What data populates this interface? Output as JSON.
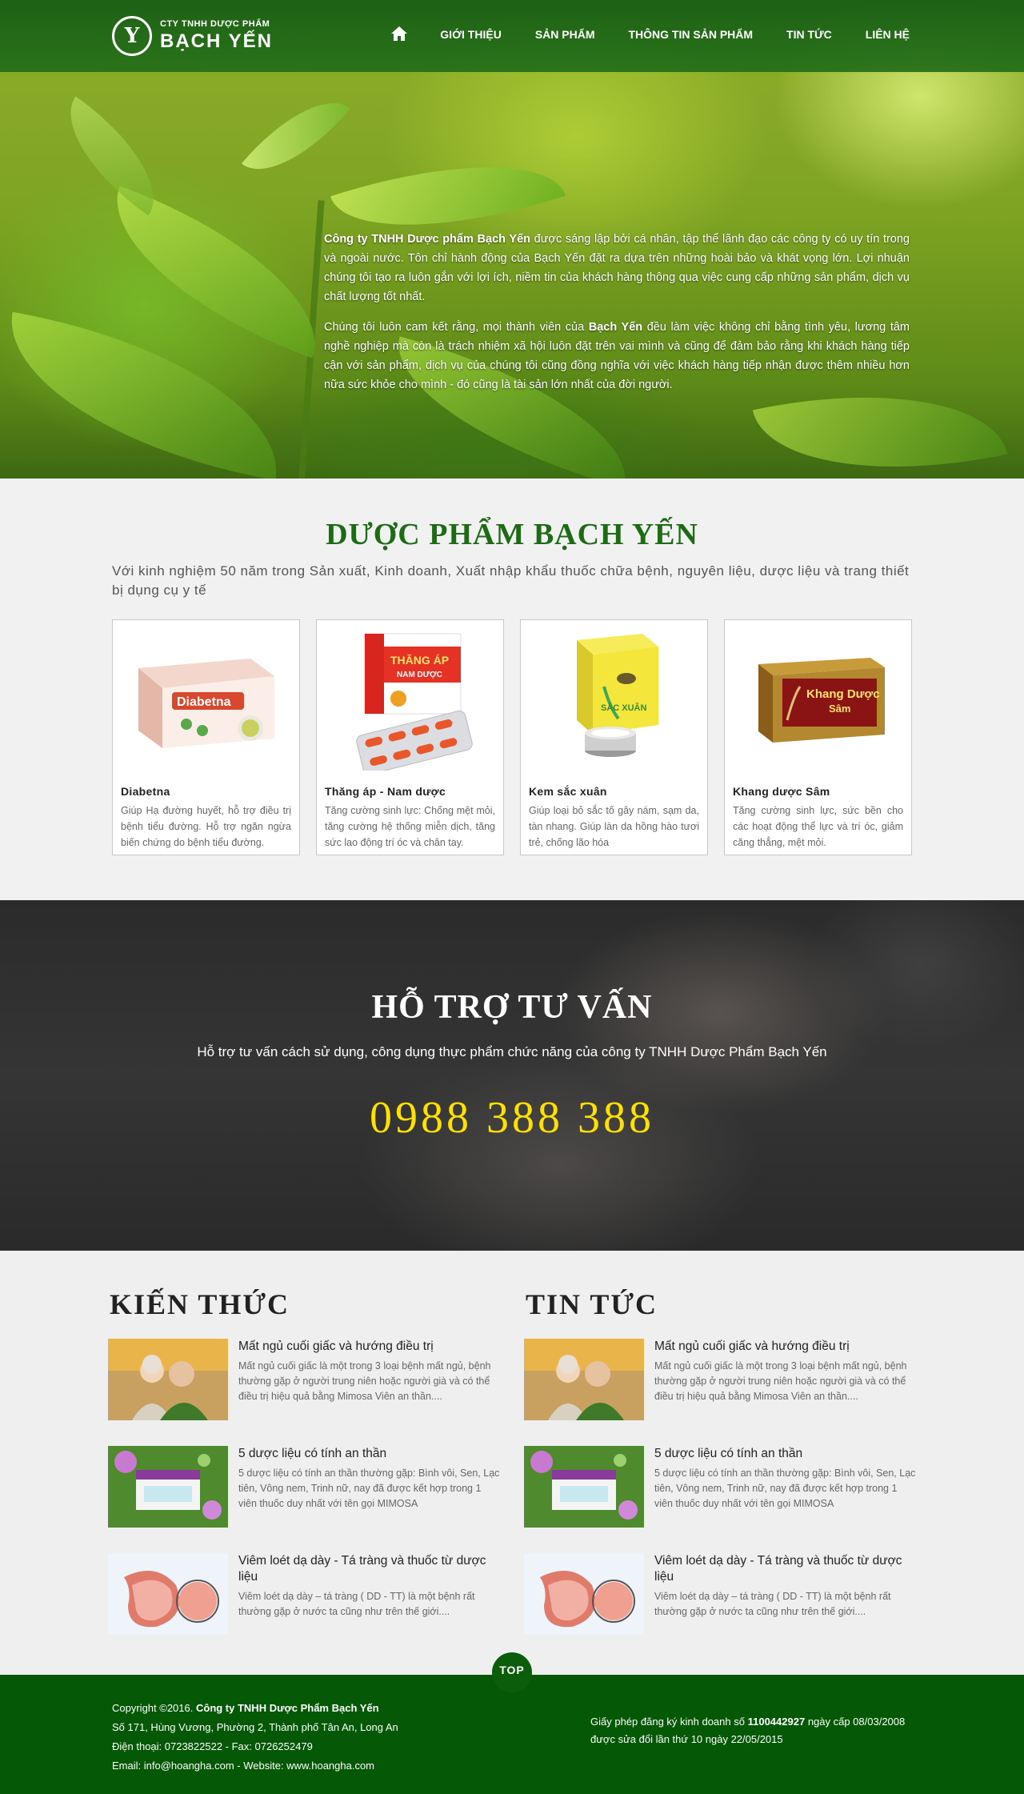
{
  "header": {
    "logo_top": "CTY TNHH DƯỢC PHẨM",
    "logo_main": "BẠCH YẾN",
    "logo_mark": "Y",
    "nav": [
      "GIỚI THIỆU",
      "SẢN PHẨM",
      "THÔNG TIN SẢN PHẨM",
      "TIN TỨC",
      "LIÊN HỆ"
    ],
    "home_icon": "home-icon"
  },
  "hero": {
    "p1_bold": "Công ty TNHH Dược phẩm Bạch Yến",
    "p1_rest": " được sáng lập bởi cá nhân, tập thể lãnh đạo các công ty có uy tín trong và ngoài nước. Tôn chỉ hành động của Bạch Yến đặt ra dựa trên những hoài bảo và khát vọng lớn. Lợi nhuận chúng tôi tạo ra luôn gắn với lợi ích, niềm tin của khách hàng thông qua việc cung cấp những sản phẩm, dịch vụ chất lượng tốt nhất.",
    "p2_start": "Chúng tôi luôn cam kết rằng, mọi thành viên của ",
    "p2_bold": "Bạch Yến",
    "p2_rest": " đều làm việc không chỉ bằng tình yêu, lương tâm nghề nghiệp mà còn là trách nhiệm xã hội luôn đặt trên vai mình và cũng để đảm bảo rằng khi khách hàng tiếp cận với sản phẩm, dịch vụ của chúng tôi cũng đồng nghĩa với việc khách hàng tiếp nhận được thêm nhiều hơn nữa sức khỏe cho mình - đó cũng là tài sản lớn nhất của đời người."
  },
  "products": {
    "title": "DƯỢC PHẨM BẠCH YẾN",
    "subtitle": "Với kinh nghiệm 50 năm trong Sản xuất, Kinh doanh, Xuất nhập khẩu thuốc chữa bệnh, nguyên liệu, dược liệu và trang thiết bị dụng cụ y tế",
    "items": [
      {
        "name": "Diabetna",
        "desc": "Giúp Hạ đường huyết, hỗ trợ điều trị bệnh tiểu đường. Hỗ trợ ngăn ngừa biến chứng do bệnh tiểu đường.",
        "box_label": "Diabetna"
      },
      {
        "name": "Thăng áp - Nam dược",
        "desc": "Tăng cường sinh lực: Chống mệt mỏi, tăng cường hệ thống miễn dịch, tăng sức lao động trí óc và chân tay.",
        "box_label": "THĂNG ÁP",
        "box_sub": "NAM DƯỢC"
      },
      {
        "name": "Kem sắc xuân",
        "desc": "Giúp loại bỏ sắc tố gây nám, sạm da, tàn nhang. Giúp làn da hồng hào tươi trẻ, chống lão hóa",
        "box_label": "SẮC XUÂN"
      },
      {
        "name": "Khang dược Sâm",
        "desc": "Tăng cường sinh lực, sức bền cho các hoạt động thể lực và trí óc, giảm căng thẳng, mệt mỏi.",
        "box_label": "Khang Dược",
        "box_sub": "Sâm"
      }
    ]
  },
  "support": {
    "title": "HỖ TRỢ TƯ VẤN",
    "subtitle": "Hỗ trợ tư vấn cách sử dụng, công dụng thực phẩm chức năng của công ty TNHH Dược Phẩm Bạch Yến",
    "phone": "0988 388 388"
  },
  "news": {
    "columns": [
      {
        "heading": "KIẾN THỨC",
        "items": [
          {
            "title": "Mất ngủ cuối giấc và hướng điều trị",
            "excerpt": "Mất ngủ cuối giấc là một trong 3 loại bệnh mất ngủ, bệnh thường gặp ở người trung niên hoặc người già và có thể điều trị hiệu quả bằng Mimosa Viên an thần...."
          },
          {
            "title": "5 dược liệu có tính an thần",
            "excerpt": "5 dược liệu có tính an thần thường gặp: Bình vôi, Sen, Lạc tiên, Vông nem, Trinh nữ, nay đã được kết hợp trong 1 viên thuốc duy nhất với tên gọi MIMOSA"
          },
          {
            "title": "Viêm loét dạ dày - Tá tràng và thuốc từ dược liệu",
            "excerpt": "Viêm loét dạ dày – tá tràng ( DD - TT) là một bệnh rất thường gặp ở nước ta cũng như trên thế giới...."
          }
        ]
      },
      {
        "heading": "TIN TỨC",
        "items": [
          {
            "title": "Mất ngủ cuối giấc và hướng điều trị",
            "excerpt": "Mất ngủ cuối giấc là một trong 3 loại bệnh mất ngủ, bệnh thường gặp ở người trung niên hoặc người già và có thể điều trị hiệu quả bằng Mimosa Viên an thần...."
          },
          {
            "title": "5 dược liệu có tính an thần",
            "excerpt": "5 dược liệu có tính an thần thường gặp: Bình vôi, Sen, Lạc tiên, Vông nem, Trinh nữ, nay đã được kết hợp trong 1 viên thuốc duy nhất với tên gọi MIMOSA"
          },
          {
            "title": "Viêm loét dạ dày - Tá tràng và thuốc từ dược liệu",
            "excerpt": "Viêm loét dạ dày – tá tràng ( DD - TT) là một bệnh rất thường gặp ở nước ta cũng như trên thế giới...."
          }
        ]
      }
    ],
    "top_button": "TOP"
  },
  "footer": {
    "copyright_prefix": "Copyright ©2016.",
    "copyright_company": "Công ty TNHH Dược Phẩm Bạch Yến",
    "address": "Số 171, Hùng Vương, Phường 2, Thành phố Tân An, Long An",
    "phone_line": "Điện thoại: 0723822522   -   Fax: 0726252479",
    "email_line": "Email: info@hoangha.com   -   Website: www.hoangha.com",
    "license_prefix": "Giấy phép đăng ký kinh doanh số",
    "license_number": "1100442927",
    "license_date": "ngày cấp 08/03/2008",
    "license_revision": "được sửa đổi lần thứ 10 ngày 22/05/2015"
  },
  "colors": {
    "brand_green": "#1d6b14",
    "header_green": "#1f6a18",
    "footer_green": "#055805",
    "phone_yellow": "#ffe000"
  }
}
